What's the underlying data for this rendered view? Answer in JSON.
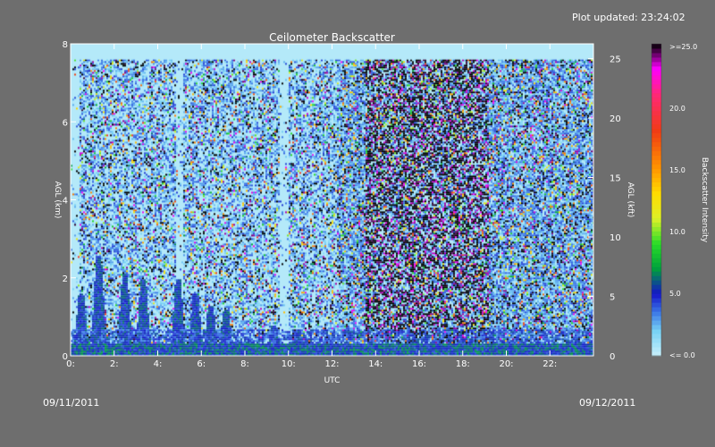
{
  "header": {
    "updated": "Plot updated: 23:24:02"
  },
  "footer": {
    "date_start": "09/11/2011",
    "date_end": "09/12/2011"
  },
  "colors": {
    "background": "#6e6e6e",
    "axes": "#ffffff",
    "text": "#ffffff"
  },
  "chart_data": {
    "type": "heatmap",
    "title": "Ceilometer Backscatter",
    "xlabel": "UTC",
    "ylabel_left": "AGL (km)",
    "ylabel_right": "AGL (kft)",
    "colorbar_label": "Backscatter Intensity",
    "xlim": [
      0,
      24
    ],
    "ylim_km": [
      0,
      8
    ],
    "ylim_kft": [
      0,
      26.25
    ],
    "x_ticks": [
      "0:",
      "2:",
      "4:",
      "6:",
      "8:",
      "10:",
      "12:",
      "14:",
      "16:",
      "18:",
      "20:",
      "22:"
    ],
    "y_ticks_left": [
      "0",
      "2",
      "4",
      "6",
      "8"
    ],
    "y_ticks_right": [
      "0",
      "5",
      "10",
      "15",
      "20",
      "25"
    ],
    "colorbar_ticks": [
      "<= 0.0",
      "5.0",
      "10.0",
      "15.0",
      "20.0",
      ">=25.0"
    ],
    "colorbar_range": [
      0,
      25
    ],
    "data_top_km": 7.6,
    "surface_layer_km": 0.35,
    "plumes": [
      {
        "x": 0.45,
        "top_km": 1.6
      },
      {
        "x": 1.25,
        "top_km": 2.6
      },
      {
        "x": 2.45,
        "top_km": 2.1
      },
      {
        "x": 3.3,
        "top_km": 2.0
      },
      {
        "x": 4.9,
        "top_km": 2.0
      },
      {
        "x": 5.7,
        "top_km": 1.6
      },
      {
        "x": 6.4,
        "top_km": 1.3
      },
      {
        "x": 7.1,
        "top_km": 1.2
      },
      {
        "x": 9.3,
        "top_km": 0.8
      },
      {
        "x": 10.4,
        "top_km": 0.7
      }
    ],
    "noise_region_start_h": 12.2,
    "dense_noise_region_h": [
      13.5,
      19.2
    ]
  }
}
